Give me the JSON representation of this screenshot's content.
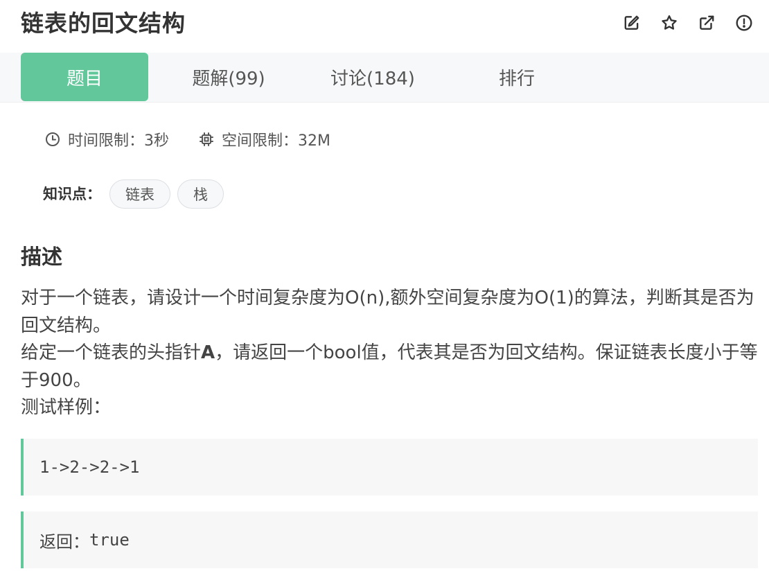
{
  "header": {
    "title": "链表的回文结构",
    "icons": [
      "edit-icon",
      "star-icon",
      "external-link-icon",
      "alert-icon"
    ]
  },
  "tabs": [
    {
      "label": "题目",
      "active": true
    },
    {
      "label": "题解(99)",
      "active": false
    },
    {
      "label": "讨论(184)",
      "active": false
    },
    {
      "label": "排行",
      "active": false
    }
  ],
  "limits": {
    "time": "时间限制：3秒",
    "space": "空间限制：32M"
  },
  "knowledge": {
    "label": "知识点：",
    "tags": [
      "链表",
      "栈"
    ]
  },
  "description": {
    "title": "描述",
    "line1": "对于一个链表，请设计一个时间复杂度为O(n),额外空间复杂度为O(1)的算法，判断其是否为回文结构。",
    "line2_prefix": "给定一个链表的头指针",
    "line2_bold": "A",
    "line2_suffix": "，请返回一个bool值，代表其是否为回文结构。保证链表长度小于等于900。",
    "line3": "测试样例："
  },
  "examples": {
    "input": "1->2->2->1",
    "output_label": "返回：",
    "output_value": "true"
  },
  "colors": {
    "accent": "#62c79a",
    "tabbar_bg": "#f7f8f9",
    "code_bg": "#f7f7f7"
  }
}
